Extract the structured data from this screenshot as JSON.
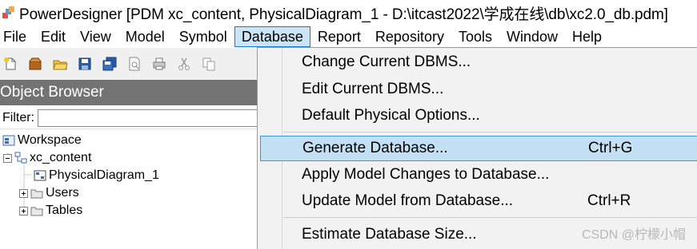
{
  "window": {
    "title": "PowerDesigner [PDM xc_content, PhysicalDiagram_1 - D:\\itcast2022\\学成在线\\db\\xc2.0_db.pdm]",
    "icon": "powerdesigner-app-icon"
  },
  "menubar": {
    "items": [
      {
        "label": "File"
      },
      {
        "label": "Edit"
      },
      {
        "label": "View"
      },
      {
        "label": "Model"
      },
      {
        "label": "Symbol"
      },
      {
        "label": "Database",
        "active": true
      },
      {
        "label": "Report"
      },
      {
        "label": "Repository"
      },
      {
        "label": "Tools"
      },
      {
        "label": "Window"
      },
      {
        "label": "Help"
      }
    ]
  },
  "toolbar": {
    "buttons": [
      {
        "icon": "new-file-icon"
      },
      {
        "icon": "open-package-icon"
      },
      {
        "icon": "open-folder-icon"
      },
      {
        "icon": "save-icon"
      },
      {
        "icon": "save-all-icon"
      },
      {
        "icon": "print-preview-icon"
      },
      {
        "icon": "print-icon"
      },
      {
        "icon": "cut-icon"
      },
      {
        "icon": "copy-icon"
      }
    ]
  },
  "object_browser": {
    "title": "Object Browser",
    "filter_label": "Filter:",
    "filter_value": "",
    "tree": [
      {
        "label": "Workspace",
        "icon": "workspace-icon"
      },
      {
        "label": "xc_content",
        "icon": "model-icon"
      },
      {
        "label": "PhysicalDiagram_1",
        "icon": "diagram-icon"
      },
      {
        "label": "Users",
        "icon": "folder-icon"
      },
      {
        "label": "Tables",
        "icon": "folder-icon"
      }
    ]
  },
  "database_menu": {
    "items": [
      {
        "label": "Change Current DBMS...",
        "shortcut": ""
      },
      {
        "label": "Edit Current DBMS...",
        "shortcut": ""
      },
      {
        "label": "Default Physical Options...",
        "shortcut": ""
      },
      {
        "label": "Generate Database...",
        "shortcut": "Ctrl+G",
        "highlighted": true
      },
      {
        "label": "Apply Model Changes to Database...",
        "shortcut": ""
      },
      {
        "label": "Update Model from Database...",
        "shortcut": "Ctrl+R"
      },
      {
        "label": "Estimate Database Size...",
        "shortcut": ""
      }
    ]
  },
  "watermark": "CSDN @柠檬小帽",
  "colors": {
    "menu_active_bg": "#cce4f7",
    "menu_active_border": "#1c78c6",
    "dropdown_bg": "#f2f2f2",
    "highlight_bg": "#c4e0f4",
    "highlight_border": "#3d97d6",
    "panel_title_bg": "#737373"
  }
}
